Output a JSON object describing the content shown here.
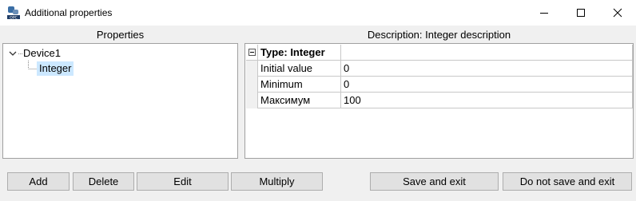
{
  "window": {
    "title": "Additional properties",
    "icon": "opc-app-icon",
    "controls": [
      "minimize-icon",
      "maximize-icon",
      "close-icon"
    ]
  },
  "properties_panel": {
    "header": "Properties",
    "tree": {
      "root": "Device1",
      "root_expanded": true,
      "children": [
        "Integer"
      ],
      "selected": "Integer"
    }
  },
  "description_panel": {
    "header": "Description: Integer description",
    "group": {
      "title": "Type: Integer",
      "collapse_symbol": "⊟"
    },
    "rows": [
      {
        "name": "Initial value",
        "value": "0"
      },
      {
        "name": "Minimum",
        "value": "0"
      },
      {
        "name": "Максимум",
        "value": "100"
      }
    ]
  },
  "buttons": {
    "add": "Add",
    "delete": "Delete",
    "edit": "Edit",
    "multiply": "Multiply",
    "save_exit": "Save and exit",
    "no_save_exit": "Do not save and exit"
  },
  "colors": {
    "selection": "#cce8ff",
    "button_face": "#e1e1e1",
    "window_bg": "#f0f0f0"
  }
}
